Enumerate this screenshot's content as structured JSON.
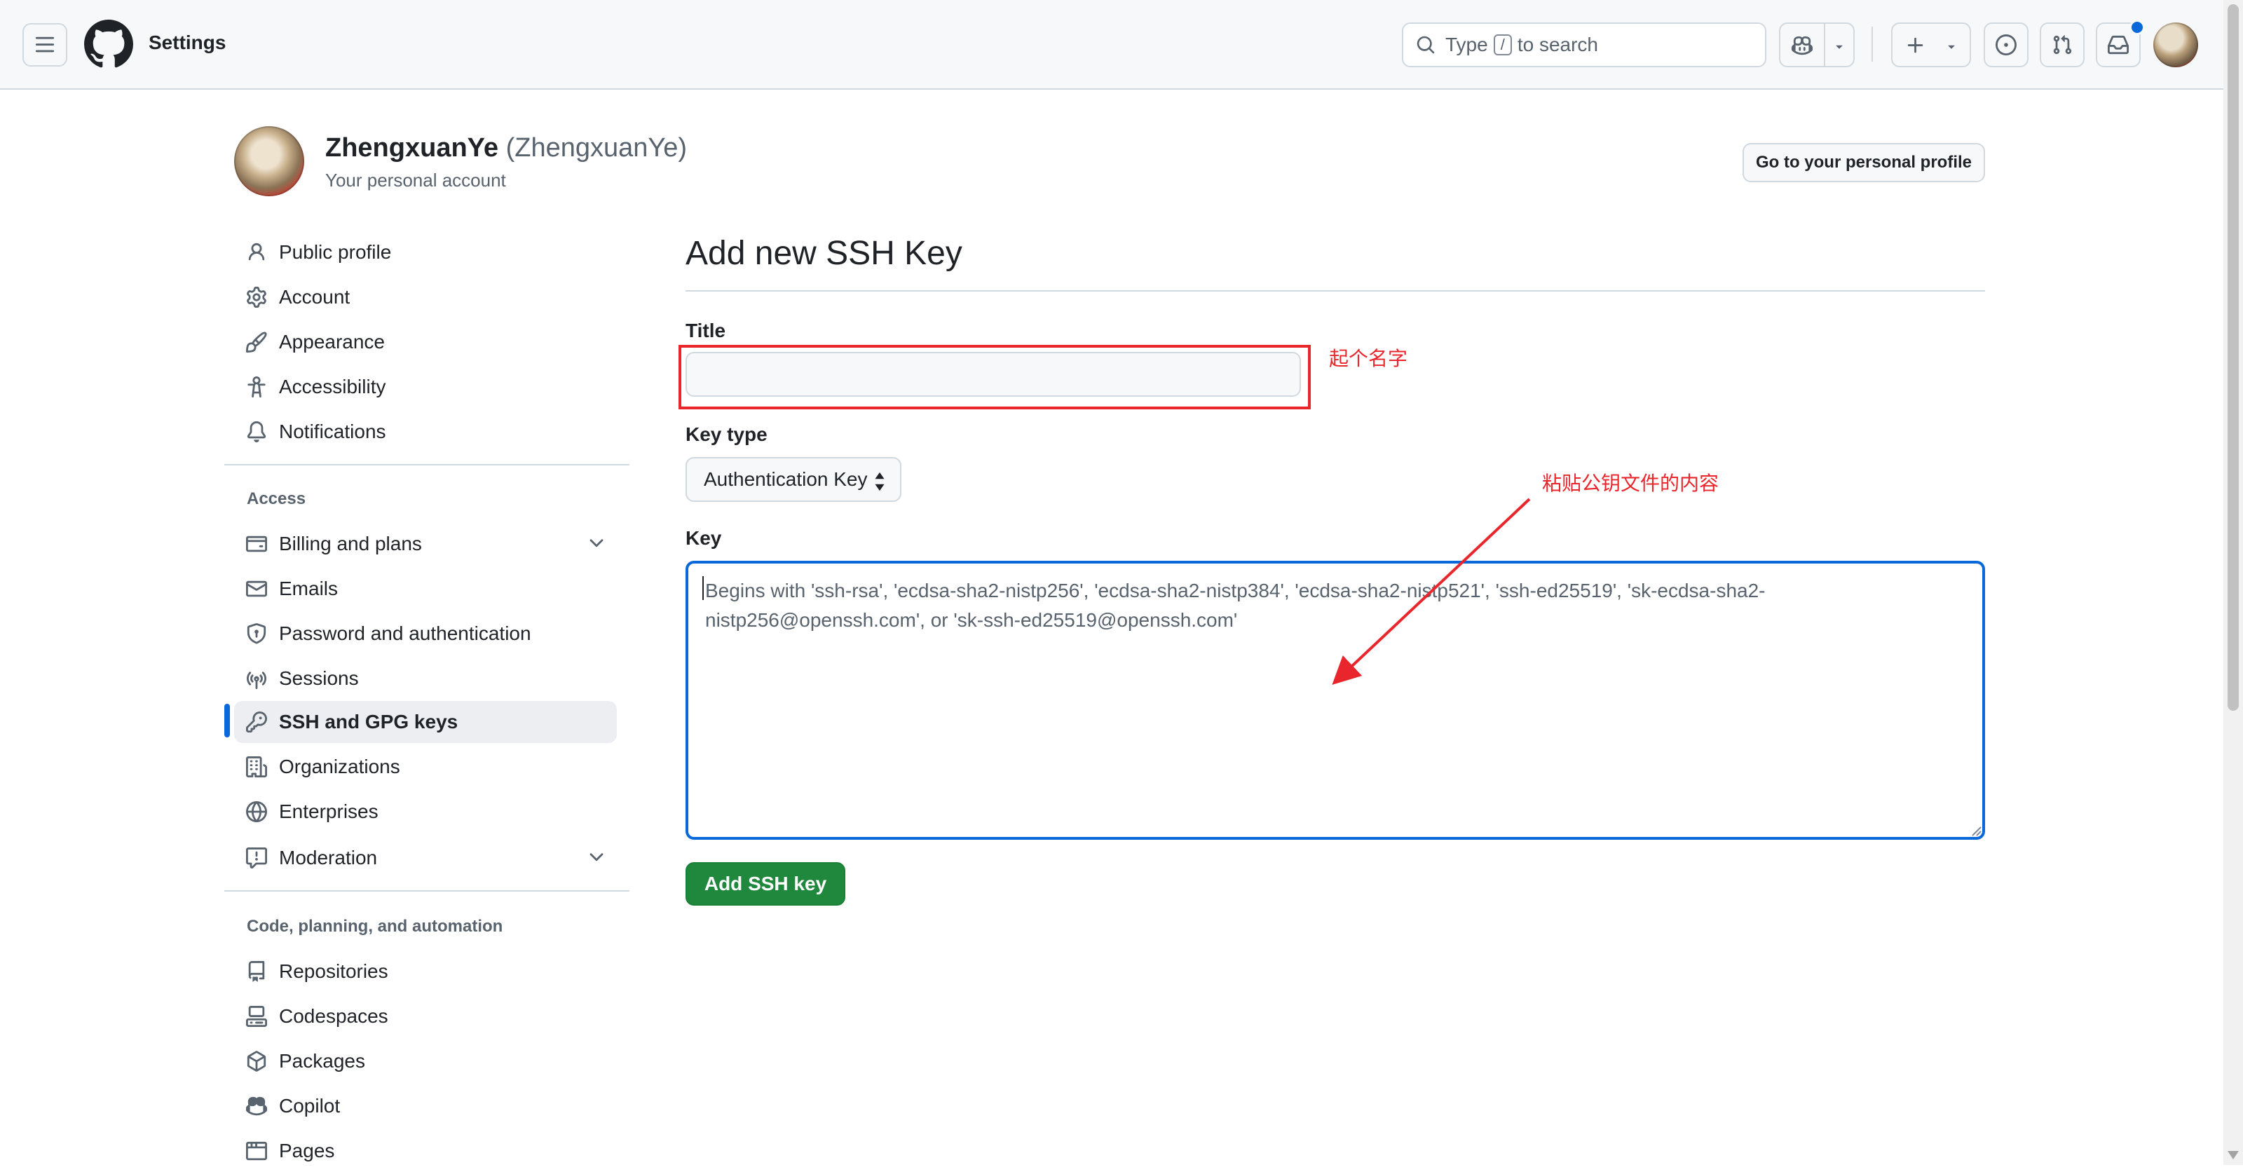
{
  "header": {
    "context_title": "Settings",
    "search_prefix": "Type",
    "search_key": "/",
    "search_suffix": "to search",
    "notification_dot_color": "#0969da"
  },
  "user": {
    "display_name": "ZhengxuanYe",
    "login": "(ZhengxuanYe)",
    "subtitle": "Your personal account",
    "profile_button": "Go to your personal profile"
  },
  "sidebar": {
    "items": [
      {
        "label": "Public profile",
        "icon": "person-icon"
      },
      {
        "label": "Account",
        "icon": "gear-icon"
      },
      {
        "label": "Appearance",
        "icon": "paintbrush-icon"
      },
      {
        "label": "Accessibility",
        "icon": "accessibility-icon"
      },
      {
        "label": "Notifications",
        "icon": "bell-icon"
      }
    ],
    "access_heading": "Access",
    "access_items": [
      {
        "label": "Billing and plans",
        "icon": "credit-card-icon",
        "expandable": true
      },
      {
        "label": "Emails",
        "icon": "mail-icon"
      },
      {
        "label": "Password and authentication",
        "icon": "shield-lock-icon"
      },
      {
        "label": "Sessions",
        "icon": "broadcast-icon"
      },
      {
        "label": "SSH and GPG keys",
        "icon": "key-icon",
        "active": true
      },
      {
        "label": "Organizations",
        "icon": "organization-icon"
      },
      {
        "label": "Enterprises",
        "icon": "globe-icon"
      },
      {
        "label": "Moderation",
        "icon": "report-icon",
        "expandable": true
      }
    ],
    "code_heading": "Code, planning, and automation",
    "code_items": [
      {
        "label": "Repositories",
        "icon": "repo-icon"
      },
      {
        "label": "Codespaces",
        "icon": "codespaces-icon"
      },
      {
        "label": "Packages",
        "icon": "package-icon"
      },
      {
        "label": "Copilot",
        "icon": "copilot-icon"
      },
      {
        "label": "Pages",
        "icon": "browser-icon"
      }
    ],
    "active_color": "#0969da"
  },
  "main": {
    "page_title": "Add new SSH Key",
    "title_label": "Title",
    "title_value": "",
    "key_type_label": "Key type",
    "key_type_selected": "Authentication Key",
    "key_label": "Key",
    "key_placeholder": "Begins with 'ssh-rsa', 'ecdsa-sha2-nistp256', 'ecdsa-sha2-nistp384', 'ecdsa-sha2-nistp521', 'ssh-ed25519', 'sk-ecdsa-sha2-nistp256@openssh.com', or 'sk-ssh-ed25519@openssh.com'",
    "submit_button": "Add SSH key",
    "submit_color": "#1f883d"
  },
  "annotations": {
    "title_note": "起个名字",
    "key_note": "粘贴公钥文件的内容",
    "color": "#e8262b"
  }
}
